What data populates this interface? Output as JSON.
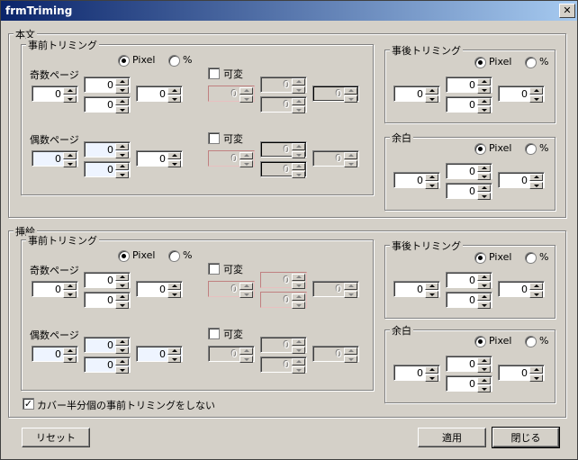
{
  "window": {
    "title": "frmTriming",
    "close_icon": "close-icon"
  },
  "honbun": {
    "title": "本文"
  },
  "sashie": {
    "title": "挿絵"
  },
  "labels": {
    "pre_trim": "事前トリミング",
    "post_trim": "事後トリミング",
    "margin": "余白",
    "odd": "奇数ページ",
    "even": "偶数ページ",
    "variable": "可変",
    "pixel": "Pixel",
    "percent": "%"
  },
  "values": {
    "zero": "0"
  },
  "cover_checkbox": {
    "label": "カバー半分個の事前トリミングをしない",
    "checked": true,
    "mark": "✓"
  },
  "buttons": {
    "reset": "リセット",
    "apply": "適用",
    "close": "閉じる"
  }
}
